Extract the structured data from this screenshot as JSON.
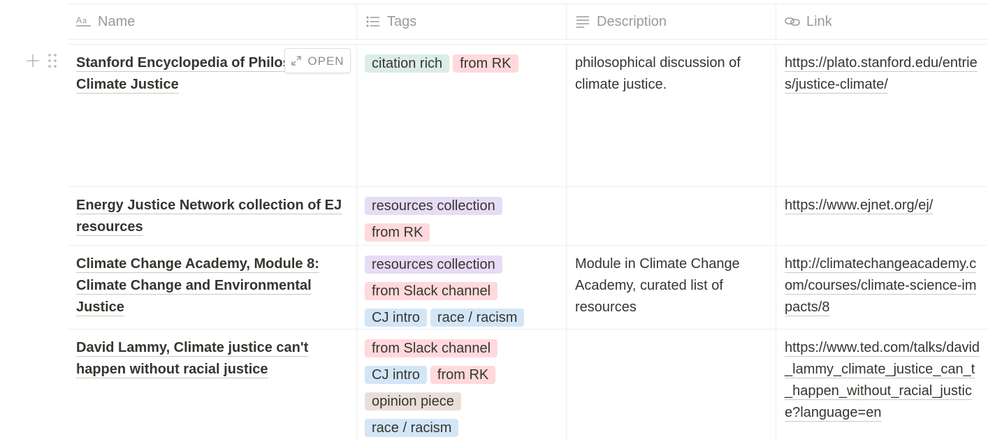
{
  "columns": {
    "name": "Name",
    "tags": "Tags",
    "description": "Description",
    "link": "Link"
  },
  "open_label": "OPEN",
  "rows": [
    {
      "name": "Stanford Encyclopedia of Philosophy: Climate Justice",
      "tags": [
        {
          "label": "citation rich",
          "color": "#dbede8"
        },
        {
          "label": "from RK",
          "color": "#ffd9db"
        }
      ],
      "description": "philosophical discussion of climate justice.",
      "link": "https://plato.stanford.edu/entries/justice-climate/"
    },
    {
      "name": "Energy Justice Network collection of EJ resources",
      "tags": [
        {
          "label": "resources collection",
          "color": "#e7dcf6"
        },
        {
          "label": "from RK",
          "color": "#ffd9db"
        }
      ],
      "description": "",
      "link": "https://www.ejnet.org/ej/"
    },
    {
      "name": "Climate Change Academy, Module 8: Climate Change and Environmental Justice",
      "tags": [
        {
          "label": "resources collection",
          "color": "#e7dcf6"
        },
        {
          "label": "from Slack channel",
          "color": "#ffd9db"
        },
        {
          "label": "CJ intro",
          "color": "#d2e6f7"
        },
        {
          "label": "race / racism",
          "color": "#d2e6f7"
        }
      ],
      "description": "Module in Climate Change Academy, curated list of resources",
      "link": "http://climatechangeacademy.com/courses/climate-science-impacts/8"
    },
    {
      "name": "David Lammy, Climate justice can't happen without racial justice",
      "tags": [
        {
          "label": "from Slack channel",
          "color": "#ffd9db"
        },
        {
          "label": "CJ intro",
          "color": "#d2e6f7"
        },
        {
          "label": "from RK",
          "color": "#ffd9db"
        },
        {
          "label": "opinion piece",
          "color": "#eadfd8"
        },
        {
          "label": "race / racism",
          "color": "#d2e6f7"
        }
      ],
      "description": "",
      "link": "https://www.ted.com/talks/david_lammy_climate_justice_can_t_happen_without_racial_justice?language=en"
    }
  ]
}
